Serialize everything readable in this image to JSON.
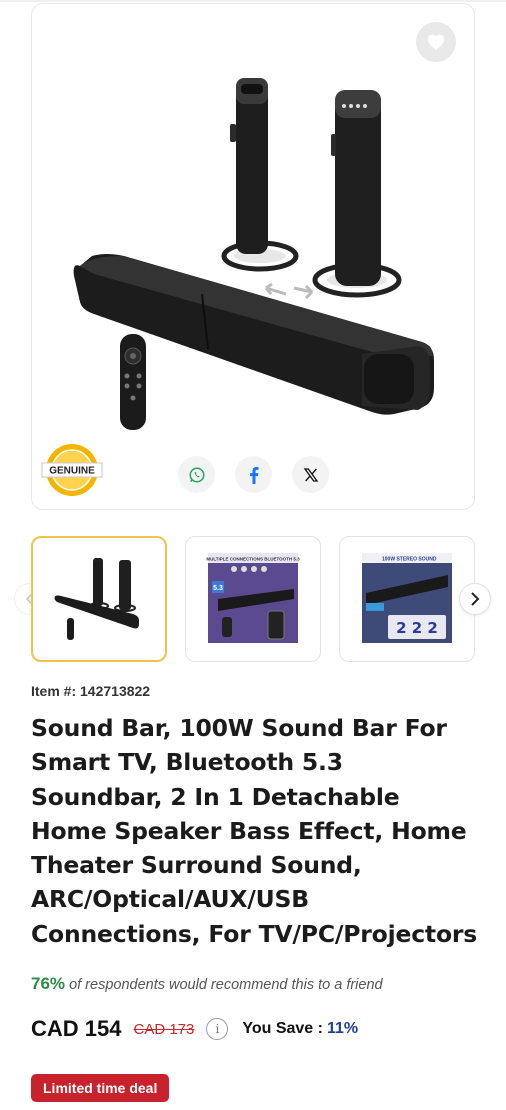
{
  "gallery": {
    "main_image": "soundbar-product-photo",
    "badge_text": "GENUINE",
    "share": [
      {
        "icon": "whatsapp-icon"
      },
      {
        "icon": "facebook-icon"
      },
      {
        "icon": "x-twitter-icon"
      }
    ],
    "thumbnails": [
      {
        "caption": ""
      },
      {
        "caption": "5.3"
      },
      {
        "caption": "2 2 2"
      }
    ],
    "thumb2_header": "MULTIPLE CONNECTIONS BLUETOOTH 5.3",
    "thumb3_header": "100W STEREO SOUND"
  },
  "product": {
    "item_number": "Item #: 142713822",
    "title": "Sound Bar, 100W Sound Bar For Smart TV, Bluetooth 5.3 Soundbar, 2 In 1 Detachable Home Speaker Bass Effect, Home Theater Surround Sound, ARC/Optical/AUX/USB Connections, For TV/PC/Projectors",
    "recommend_pct": "76%",
    "recommend_text": "of respondents would recommend this to a friend",
    "price": "CAD 154",
    "old_price": "CAD 173",
    "save_label": "You Save :",
    "save_value": "11%",
    "deal_badge": "Limited time deal"
  },
  "colors": {
    "accent_red": "#c8232c",
    "recommend_green": "#2e8b46",
    "save_blue": "#1f3f96",
    "thumb_active_border": "#f2c34a"
  }
}
